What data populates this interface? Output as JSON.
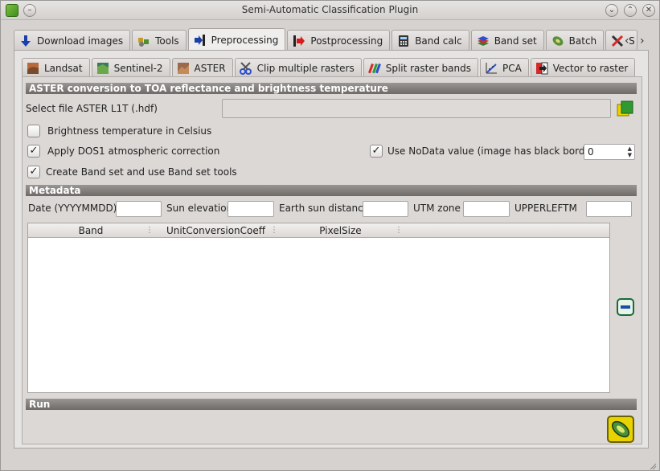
{
  "window": {
    "title": "Semi-Automatic Classification Plugin"
  },
  "main_tabs": [
    {
      "label": "Download images",
      "icon": "download-icon"
    },
    {
      "label": "Tools",
      "icon": "tools-icon"
    },
    {
      "label": "Preprocessing",
      "icon": "preprocessing-icon",
      "active": true
    },
    {
      "label": "Postprocessing",
      "icon": "postprocessing-icon"
    },
    {
      "label": "Band calc",
      "icon": "band-calc-icon"
    },
    {
      "label": "Band set",
      "icon": "band-set-icon"
    },
    {
      "label": "Batch",
      "icon": "batch-icon"
    },
    {
      "label": "S",
      "icon": "settings-icon"
    }
  ],
  "sub_tabs": [
    {
      "label": "Landsat",
      "icon": "landsat-icon"
    },
    {
      "label": "Sentinel-2",
      "icon": "sentinel-icon"
    },
    {
      "label": "ASTER",
      "icon": "aster-icon",
      "active": true
    },
    {
      "label": "Clip multiple rasters",
      "icon": "clip-icon"
    },
    {
      "label": "Split raster bands",
      "icon": "split-icon"
    },
    {
      "label": "PCA",
      "icon": "pca-icon"
    },
    {
      "label": "Vector to raster",
      "icon": "vector-raster-icon"
    }
  ],
  "aster": {
    "section_title": "ASTER conversion to TOA reflectance and brightness temperature",
    "select_file_label": "Select file ASTER L1T (.hdf)",
    "select_file_value": "",
    "brightness_celsius_label": "Brightness temperature in Celsius",
    "brightness_celsius_checked": false,
    "dos1_label": "Apply DOS1 atmospheric correction",
    "dos1_checked": true,
    "nodata_label": "Use NoData value (image has black border)",
    "nodata_checked": true,
    "nodata_value": "0",
    "bandset_label": "Create Band set and use Band set tools",
    "bandset_checked": true
  },
  "metadata": {
    "section_title": "Metadata",
    "date_label": "Date (YYYYMMDD)",
    "date_value": "",
    "sun_elevation_label": "Sun elevation",
    "sun_elevation_value": "",
    "earth_sun_distance_label": "Earth sun distance",
    "earth_sun_distance_value": "",
    "utm_zone_label": "UTM zone",
    "utm_zone_value": "",
    "upperleftm_label": "UPPERLEFTM",
    "upperleftm_value": "",
    "table_columns": [
      "Band",
      "UnitConversionCoeff",
      "PixelSize"
    ],
    "table_rows": []
  },
  "run": {
    "section_title": "Run"
  },
  "colors": {
    "section_header": "#7a7674",
    "accent_green": "#2f9a2f",
    "accent_yellow": "#e8d200"
  }
}
